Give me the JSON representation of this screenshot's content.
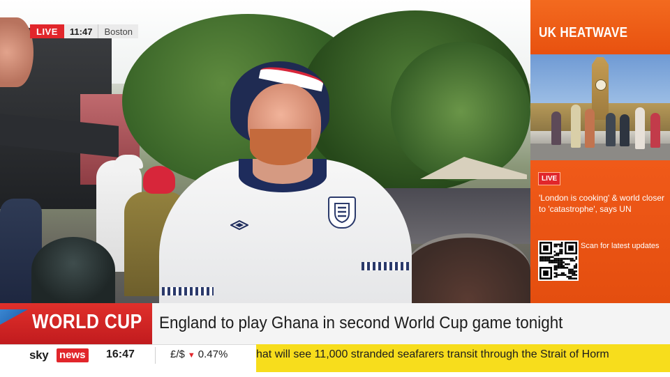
{
  "live_badge": {
    "label": "LIVE",
    "time": "11:47",
    "location": "Boston"
  },
  "side_panel": {
    "title": "UK HEATWAVE",
    "live_label": "LIVE",
    "story": "'London is cooking' & world closer to 'catastrophe', says UN",
    "qr_caption": "Scan for latest updates"
  },
  "lower_third": {
    "topic": "WORLD CUP",
    "headline": "England to play Ghana in second World Cup game tonight"
  },
  "ticker": {
    "logo_sky": "sky",
    "logo_news": "news",
    "clock": "16:47",
    "fx_pair": "£/$",
    "fx_change": "0.47%",
    "fx_direction_icon": "triangle-down-icon",
    "scroll_text": "hat will see 11,000 stranded seafarers transit through the Strait of Horm"
  },
  "colors": {
    "sky_red": "#e1262b",
    "heatwave_orange": "#f05a19",
    "ticker_yellow": "#f7dd1c"
  }
}
